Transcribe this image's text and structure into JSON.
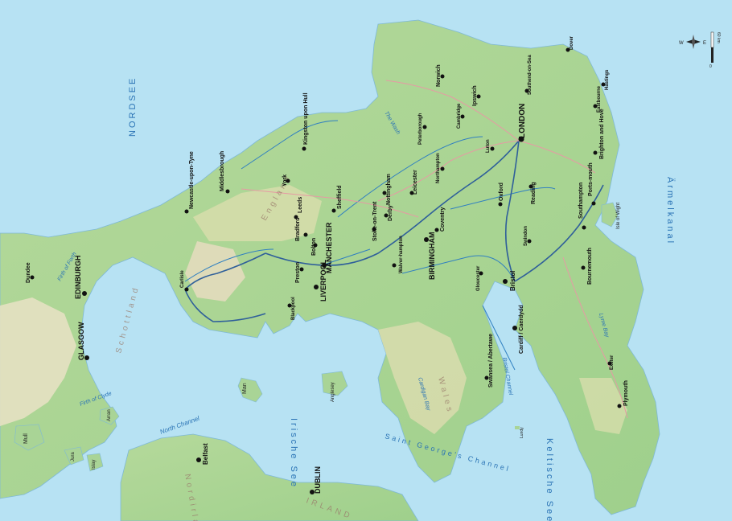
{
  "colors": {
    "sea": "#b7e2f3",
    "lowland": "#9fd08c",
    "upland": "#cdd9a0",
    "highland": "#e6e1c2",
    "river": "#2f7fc1",
    "road": "#e69aa4",
    "route": "#2f5f9a"
  },
  "scale": {
    "label": "60 km",
    "zero": "0"
  },
  "compass": {
    "west": "W",
    "east": "E"
  },
  "seas": [
    {
      "id": "nordsee",
      "label": "NORDSEE"
    },
    {
      "id": "irische-see",
      "label": "Irische See"
    },
    {
      "id": "aermelkanal",
      "label": "Ärmelkanal"
    },
    {
      "id": "keltische-see",
      "label": "Keltische See"
    },
    {
      "id": "saint-georges",
      "label": "Saint George's Channel"
    },
    {
      "id": "north-channel",
      "label": "North Channel"
    },
    {
      "id": "cardigan-bay",
      "label": "Cardigan Bay"
    },
    {
      "id": "bristol-channel",
      "label": "Bristol Channel"
    },
    {
      "id": "lyme-bay",
      "label": "Lyme Bay"
    },
    {
      "id": "firth-of-clyde",
      "label": "Firth of Clyde"
    },
    {
      "id": "firth-of-forth",
      "label": "Firth of Forth"
    },
    {
      "id": "the-wash",
      "label": "The Wash"
    }
  ],
  "regions": [
    {
      "id": "schottland",
      "label": "Schottland"
    },
    {
      "id": "england",
      "label": "England"
    },
    {
      "id": "wales",
      "label": "Wales"
    },
    {
      "id": "nordirland",
      "label": "Nordirland"
    },
    {
      "id": "irland",
      "label": "IRLAND"
    }
  ],
  "cities": [
    {
      "id": "london",
      "label": "LONDON"
    },
    {
      "id": "edinburgh",
      "label": "EDINBURGH"
    },
    {
      "id": "glasgow",
      "label": "GLASGOW"
    },
    {
      "id": "manchester",
      "label": "MANCHESTER"
    },
    {
      "id": "liverpool",
      "label": "LIVERPOOL"
    },
    {
      "id": "birmingham",
      "label": "BIRMINGHAM"
    },
    {
      "id": "cardiff",
      "label": "Cardiff / Caerdydd"
    },
    {
      "id": "dublin",
      "label": "DUBLIN"
    },
    {
      "id": "belfast",
      "label": "Belfast"
    },
    {
      "id": "bristol",
      "label": "Bristol"
    },
    {
      "id": "leeds",
      "label": "Leeds"
    },
    {
      "id": "sheffield",
      "label": "Sheffield"
    },
    {
      "id": "nottingham",
      "label": "Nottingham"
    },
    {
      "id": "leicester",
      "label": "Leicester"
    },
    {
      "id": "york",
      "label": "York"
    },
    {
      "id": "norwich",
      "label": "Norwich"
    },
    {
      "id": "ipswich",
      "label": "Ipswich"
    },
    {
      "id": "oxford",
      "label": "Oxford"
    },
    {
      "id": "reading",
      "label": "Reading"
    },
    {
      "id": "southampton",
      "label": "Southampton"
    },
    {
      "id": "portsmouth",
      "label": "Ports-mouth"
    },
    {
      "id": "brighton",
      "label": "Brighton and Hove"
    },
    {
      "id": "bournemouth",
      "label": "Bournemouth"
    },
    {
      "id": "plymouth",
      "label": "Plymouth"
    },
    {
      "id": "swansea",
      "label": "Swansea / Abertawe"
    },
    {
      "id": "coventry",
      "label": "Coventry"
    },
    {
      "id": "stoke",
      "label": "Stoke-on-Trent"
    },
    {
      "id": "derby",
      "label": "Derby"
    },
    {
      "id": "bradford",
      "label": "Bradford"
    },
    {
      "id": "preston",
      "label": "Preston"
    },
    {
      "id": "bolton",
      "label": "Bolton"
    },
    {
      "id": "kingston",
      "label": "Kingston upon Hull"
    },
    {
      "id": "newcastle",
      "label": "Newcastle-upon-Tyne"
    },
    {
      "id": "middlesbrough",
      "label": "Middlesbrough"
    },
    {
      "id": "dundee",
      "label": "Dundee"
    },
    {
      "id": "carlisle",
      "label": "Carlisle"
    },
    {
      "id": "blackpool",
      "label": "Blackpool"
    },
    {
      "id": "wolverhampton",
      "label": "Walver-hampton"
    },
    {
      "id": "luton",
      "label": "Luton"
    },
    {
      "id": "exeter",
      "label": "Exeter"
    },
    {
      "id": "southend",
      "label": "Southend-on-Sea"
    },
    {
      "id": "dover",
      "label": "Dover"
    },
    {
      "id": "hastings",
      "label": "Hastings"
    },
    {
      "id": "eastbourne",
      "label": "Eastbourne"
    },
    {
      "id": "peterborough",
      "label": "Peterborough"
    },
    {
      "id": "cambridge",
      "label": "Cambridge"
    },
    {
      "id": "northampton",
      "label": "Northampton"
    },
    {
      "id": "gloucester",
      "label": "Gloucester"
    },
    {
      "id": "swindon",
      "label": "Swindon"
    }
  ],
  "islands": [
    {
      "id": "isle-of-wight",
      "label": "Isle of Wight"
    },
    {
      "id": "anglesey",
      "label": "Anglesey"
    },
    {
      "id": "man",
      "label": "Man"
    },
    {
      "id": "mull",
      "label": "Mull"
    },
    {
      "id": "islay",
      "label": "Islay"
    },
    {
      "id": "jura",
      "label": "Jura"
    },
    {
      "id": "arran",
      "label": "Arran"
    },
    {
      "id": "lundy",
      "label": "Lundy"
    }
  ]
}
